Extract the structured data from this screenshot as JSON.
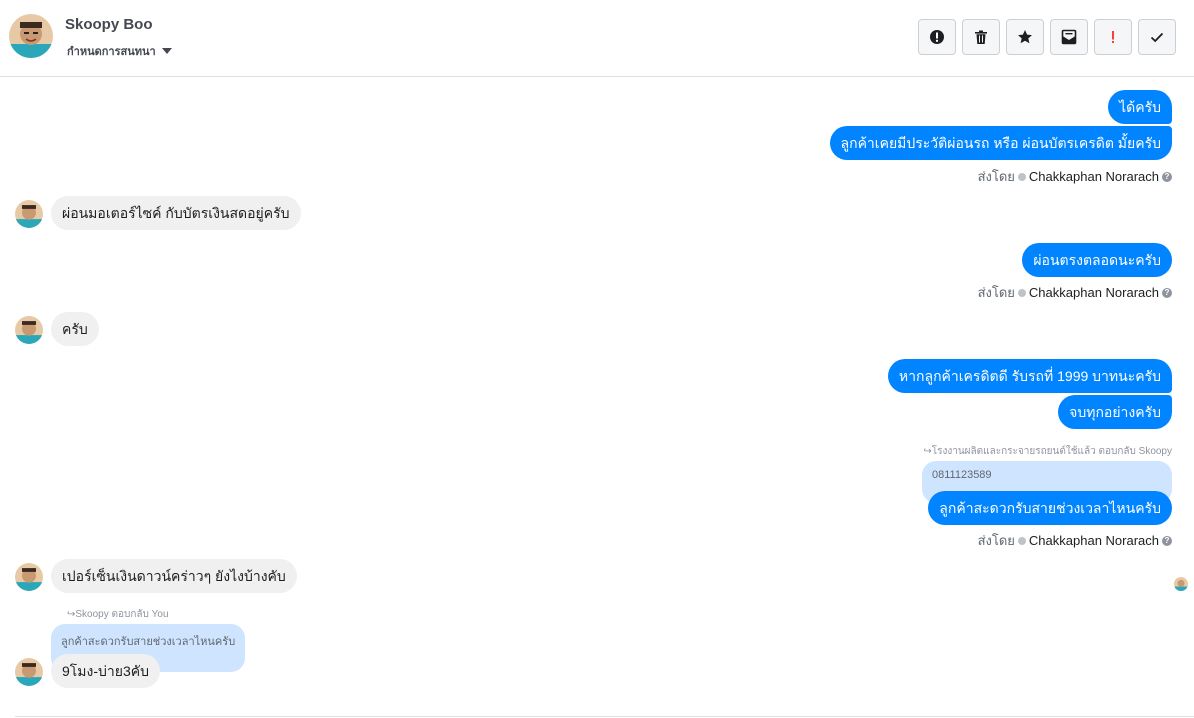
{
  "header": {
    "contact_name": "Skoopy Boo",
    "assign_label": "กำหนดการสนทนา",
    "toolbar": [
      {
        "name": "spam-button",
        "icon": "exclamation-circle-icon"
      },
      {
        "name": "delete-button",
        "icon": "trash-icon"
      },
      {
        "name": "star-button",
        "icon": "star-icon"
      },
      {
        "name": "unread-button",
        "icon": "envelope-open-icon"
      },
      {
        "name": "follow-up-button",
        "icon": "exclamation-icon"
      },
      {
        "name": "done-button",
        "icon": "check-icon"
      }
    ]
  },
  "messages": {
    "m1": "ได้ครับ",
    "m2": "ลูกค้าเคยมีประวัติผ่อนรถ หรือ ผ่อนบัตรเครดิต มั้ยครับ",
    "m3": "ผ่อนมอเตอร์ไซค์ กับบัตรเงินสดอยู่ครับ",
    "m4": "ผ่อนตรงตลอดนะครับ",
    "m5": "ครับ",
    "m6": "หากลูกค้าเครดิตดี รับรถที่ 1999 บาทนะครับ",
    "m7": "จบทุกอย่างครับ",
    "m8_reply_hint": "โรงงานผลิตและกระจายรถยนต์ใช้แล้ว ตอบกลับ Skoopy",
    "m8_quoted": "0811123589",
    "m8": "ลูกค้าสะดวกรับสายช่วงเวลาไหนครับ",
    "m9": "เปอร์เซ็นเงินดาวน์คร่าวๆ ยังไงบ้างคับ",
    "m10_reply_hint": "Skoopy ตอบกลับ You",
    "m10_quoted": "ลูกค้าสะดวกรับสายช่วงเวลาไหนครับ",
    "m10": "9โมง-บ่าย3คับ"
  },
  "sent_by": {
    "label": "ส่งโดย",
    "agent": "Chakkaphan Norarach"
  },
  "colors": {
    "outgoing_bubble": "#0084ff",
    "incoming_bubble": "#f0f0f0",
    "quoted_bubble": "#cfe5ff",
    "follow_up_icon": "#fa3e3e"
  }
}
